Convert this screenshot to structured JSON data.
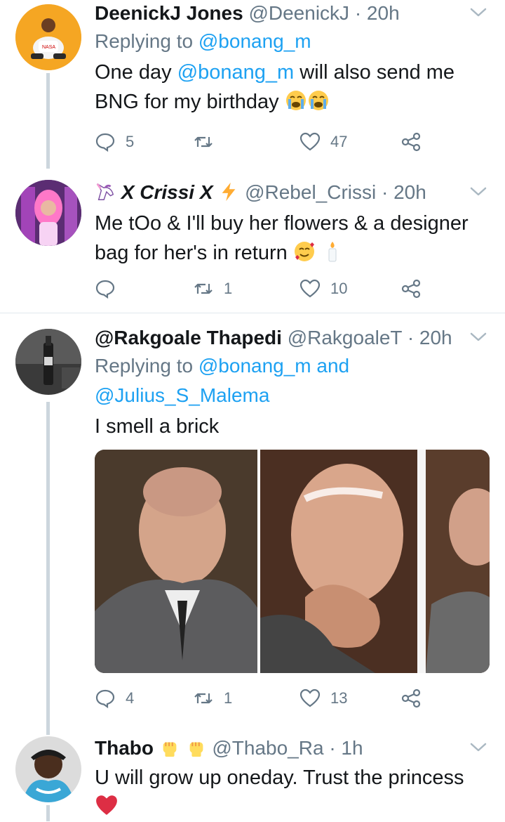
{
  "tweets": [
    {
      "name": "DeenickJ Jones",
      "handle": "@DeenickJ",
      "time": "· 20h",
      "reply_prefix": "Replying to ",
      "reply_handles": "@bonang_m",
      "body_pre": "One day ",
      "body_mention": "@bonang_m",
      "body_line1_rest": " will also send me",
      "body_line2": "BNG for my birthday",
      "replies": "5",
      "retweets": "",
      "likes": "47"
    },
    {
      "name": "X Crissi X",
      "handle": "@Rebel_Crissi",
      "time": "· 20h",
      "body_line1": "Me tOo & I'll buy her flowers & a designer",
      "body_line2": "bag for her's in return",
      "replies": "",
      "retweets": "1",
      "likes": "10"
    },
    {
      "name": "@Rakgoale Thapedi",
      "handle": "@RakgoaleT",
      "time": "· 20h",
      "reply_prefix": "Replying to ",
      "reply_handles": "@bonang_m and",
      "reply_handles2": "@Julius_S_Malema",
      "body_line1": "I smell a brick",
      "replies": "4",
      "retweets": "1",
      "likes": "13"
    },
    {
      "name": "Thabo",
      "handle": "@Thabo_Ra",
      "time": "· 1h",
      "body_line1": "U will grow up oneday. Trust the princess"
    }
  ],
  "colors": {
    "link": "#1da1f2",
    "muted": "#657786",
    "text": "#14171a",
    "heart": "#e0245e"
  },
  "icons": [
    "reply-icon",
    "retweet-icon",
    "like-icon",
    "share-icon",
    "chevron-down-icon"
  ]
}
